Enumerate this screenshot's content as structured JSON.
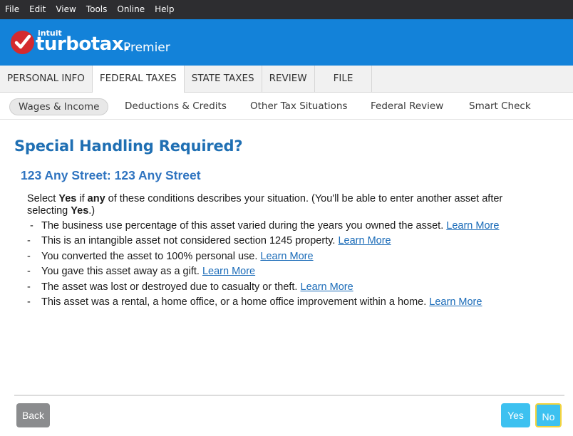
{
  "menu": [
    "File",
    "Edit",
    "View",
    "Tools",
    "Online",
    "Help"
  ],
  "brand": {
    "maker": "intuit",
    "product": "turbotax.",
    "edition": "Premier"
  },
  "main_tabs": [
    {
      "label": "PERSONAL INFO",
      "active": false
    },
    {
      "label": "FEDERAL TAXES",
      "active": true
    },
    {
      "label": "STATE TAXES",
      "active": false
    },
    {
      "label": "REVIEW",
      "active": false
    },
    {
      "label": "FILE",
      "active": false
    }
  ],
  "sub_tabs": [
    {
      "label": "Wages & Income",
      "active": true
    },
    {
      "label": "Deductions & Credits",
      "active": false
    },
    {
      "label": "Other Tax Situations",
      "active": false
    },
    {
      "label": "Federal Review",
      "active": false
    },
    {
      "label": "Smart Check",
      "active": false
    }
  ],
  "page": {
    "title": "Special Handling Required?",
    "asset": "123 Any Street: 123 Any Street",
    "intro": {
      "p1": "Select ",
      "b1": "Yes",
      "p2": " if ",
      "b2": "any",
      "p3": " of these conditions describes your situation. (You'll be able to enter another asset after selecting ",
      "b3": "Yes",
      "p4": ".)"
    },
    "conditions": [
      {
        "text": "The business use percentage of this asset varied during the years you owned the asset.",
        "link": "Learn More"
      },
      {
        "text": "This is an intangible asset not considered section 1245 property.",
        "link": "Learn More"
      },
      {
        "text": "You converted the asset to 100% personal use.",
        "link": "Learn More"
      },
      {
        "text": "You gave this asset away as a gift.",
        "link": "Learn More"
      },
      {
        "text": "The asset was lost or destroyed due to casualty or theft.",
        "link": "Learn More"
      },
      {
        "text": "This asset was a rental, a home office, or a home office improvement within a home.",
        "link": "Learn More"
      }
    ],
    "dash": "-"
  },
  "buttons": {
    "back": "Back",
    "yes": "Yes",
    "no": "No"
  },
  "colors": {
    "menubar": "#2d2d30",
    "brand": "#1382d9",
    "logo_red": "#d42a2e",
    "title_blue": "#1f6fb3",
    "link_blue": "#1a6bb8",
    "button_cyan": "#3dc1f0",
    "focus_yellow": "#f4d33b"
  }
}
